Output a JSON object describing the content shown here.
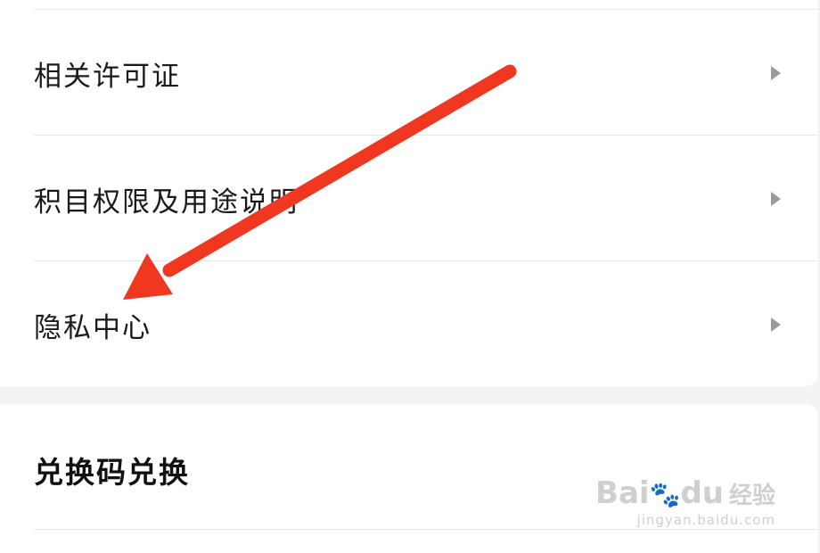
{
  "menu": {
    "items": [
      {
        "label": "相关许可证"
      },
      {
        "label": "积目权限及用途说明"
      },
      {
        "label": "隐私中心"
      }
    ]
  },
  "redeem": {
    "title": "兑换码兑换"
  },
  "watermark": {
    "brand": "Bai",
    "paw": "🐾",
    "brand_end": "du",
    "brand_cn": "经验",
    "site": "jingyan.baidu.com"
  },
  "colors": {
    "arrow": "#f0371f",
    "background": "#f3f3f3",
    "card": "#ffffff"
  }
}
